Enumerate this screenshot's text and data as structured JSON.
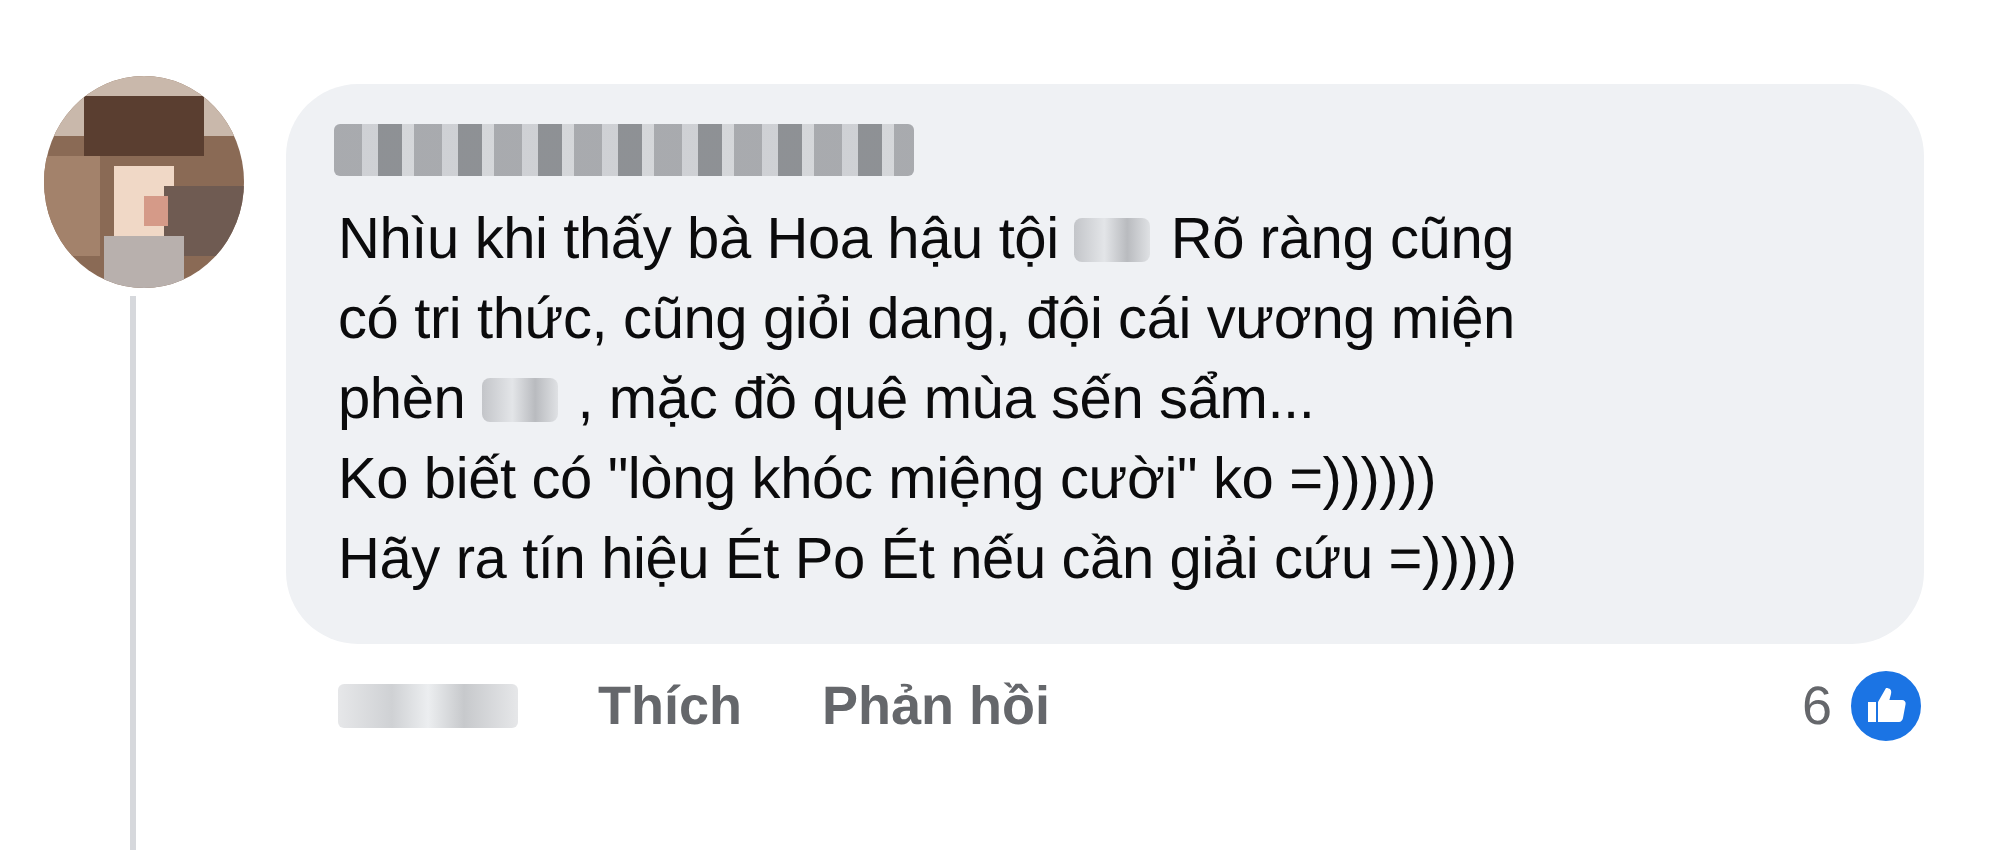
{
  "comment": {
    "lines": [
      [
        {
          "kind": "text",
          "text": "Nhìu khi thấy bà Hoa hậu tội"
        },
        {
          "kind": "blur"
        },
        {
          "kind": "text",
          "text": "Rõ ràng cũng"
        }
      ],
      [
        {
          "kind": "text",
          "text": "có tri thức, cũng giỏi dang, đội cái vương miện"
        }
      ],
      [
        {
          "kind": "text",
          "text": "phèn"
        },
        {
          "kind": "blur"
        },
        {
          "kind": "text",
          "text": ", mặc đồ quê mùa sến sẩm..."
        }
      ],
      [
        {
          "kind": "text",
          "text": "Ko biết có \"lòng khóc miệng cười\" ko =))))))"
        }
      ],
      [
        {
          "kind": "text",
          "text": "Hãy ra tín hiệu Ét Po Ét nếu cần giải cứu =)))))"
        }
      ]
    ]
  },
  "actions": {
    "like": "Thích",
    "reply": "Phản hồi",
    "reaction_count": "6"
  }
}
